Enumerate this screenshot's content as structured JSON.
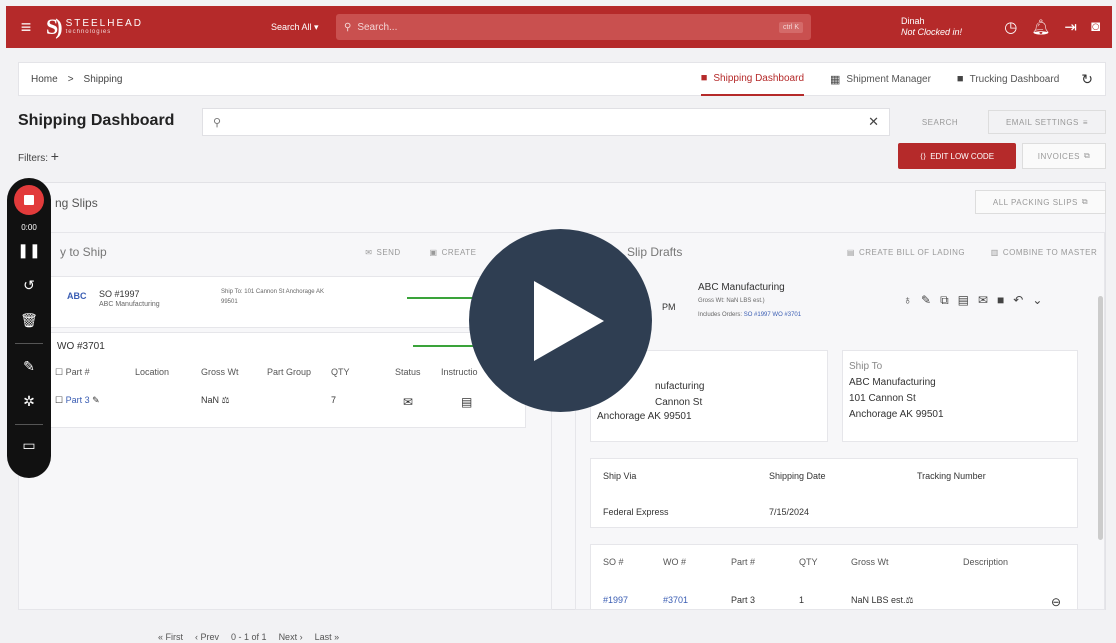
{
  "header": {
    "brand": "STEELHEAD",
    "brand_sub": "technologies",
    "search_scope": "Search All ▾",
    "search_placeholder": "Search...",
    "search_kbd": "ctrl K",
    "user_name": "Dinah",
    "user_status": "Not Clocked in!"
  },
  "breadcrumb": {
    "home": "Home",
    "sep": ">",
    "current": "Shipping"
  },
  "tabs": [
    {
      "label": "Shipping Dashboard",
      "icon": "truck-icon"
    },
    {
      "label": "Shipment Manager",
      "icon": "boxes-icon"
    },
    {
      "label": "Trucking Dashboard",
      "icon": "truck-icon"
    }
  ],
  "page": {
    "title": "Shipping Dashboard",
    "search_btn": "SEARCH",
    "email_btn": "EMAIL SETTINGS",
    "filters": "Filters:",
    "edit_btn": "EDIT LOW CODE",
    "invoices_btn": "INVOICES"
  },
  "packing": {
    "title": "ng Slips",
    "all_btn": "ALL PACKING SLIPS",
    "ready_title": "y to Ship",
    "send_btn": "SEND",
    "create_btn": "CREATE",
    "drafts_title": "Slip Drafts",
    "bol_btn": "CREATE BILL OF LADING",
    "combine_btn": "COMBINE TO MASTER"
  },
  "order": {
    "so": "SO #1997",
    "customer": "ABC Manufacturing",
    "ship_to": "Ship To: 101 Cannon St Anchorage AK",
    "ship_to_zip": "99501",
    "wo": "WO #3701"
  },
  "table": {
    "headers": [
      "Part #",
      "Location",
      "Gross Wt",
      "Part Group",
      "QTY",
      "Status",
      "Instructio"
    ],
    "row": {
      "part": "Part 3",
      "gross": "NaN ⚖",
      "qty": "7"
    }
  },
  "draft": {
    "customer": "ABC Manufacturing",
    "time": "PM",
    "gross": "Gross Wt: NaN LBS est.)",
    "includes": "Includes Orders:",
    "so_link": "SO #1997",
    "wo_link": "WO #3701"
  },
  "ship_from": {
    "line1": "nufacturing",
    "line2": "Cannon St",
    "line3": "Anchorage AK 99501"
  },
  "ship_to": {
    "label": "Ship To",
    "line1": "ABC Manufacturing",
    "line2": "101 Cannon St",
    "line3": "Anchorage AK 99501"
  },
  "shipping": {
    "h_via": "Ship Via",
    "h_date": "Shipping Date",
    "h_track": "Tracking Number",
    "via": "Federal Express",
    "date": "7/15/2024"
  },
  "lines": {
    "headers": [
      "SO #",
      "WO #",
      "Part #",
      "QTY",
      "Gross Wt",
      "Description"
    ],
    "row": {
      "so": "#1997",
      "wo": "#3701",
      "part": "Part 3",
      "qty": "1",
      "gross": "NaN LBS est.⚖"
    }
  },
  "recorder": {
    "time": "0:00"
  },
  "pager": {
    "first": "« First",
    "prev": "‹ Prev",
    "range": "0 - 1 of 1",
    "next": "Next ›",
    "last": "Last »"
  }
}
